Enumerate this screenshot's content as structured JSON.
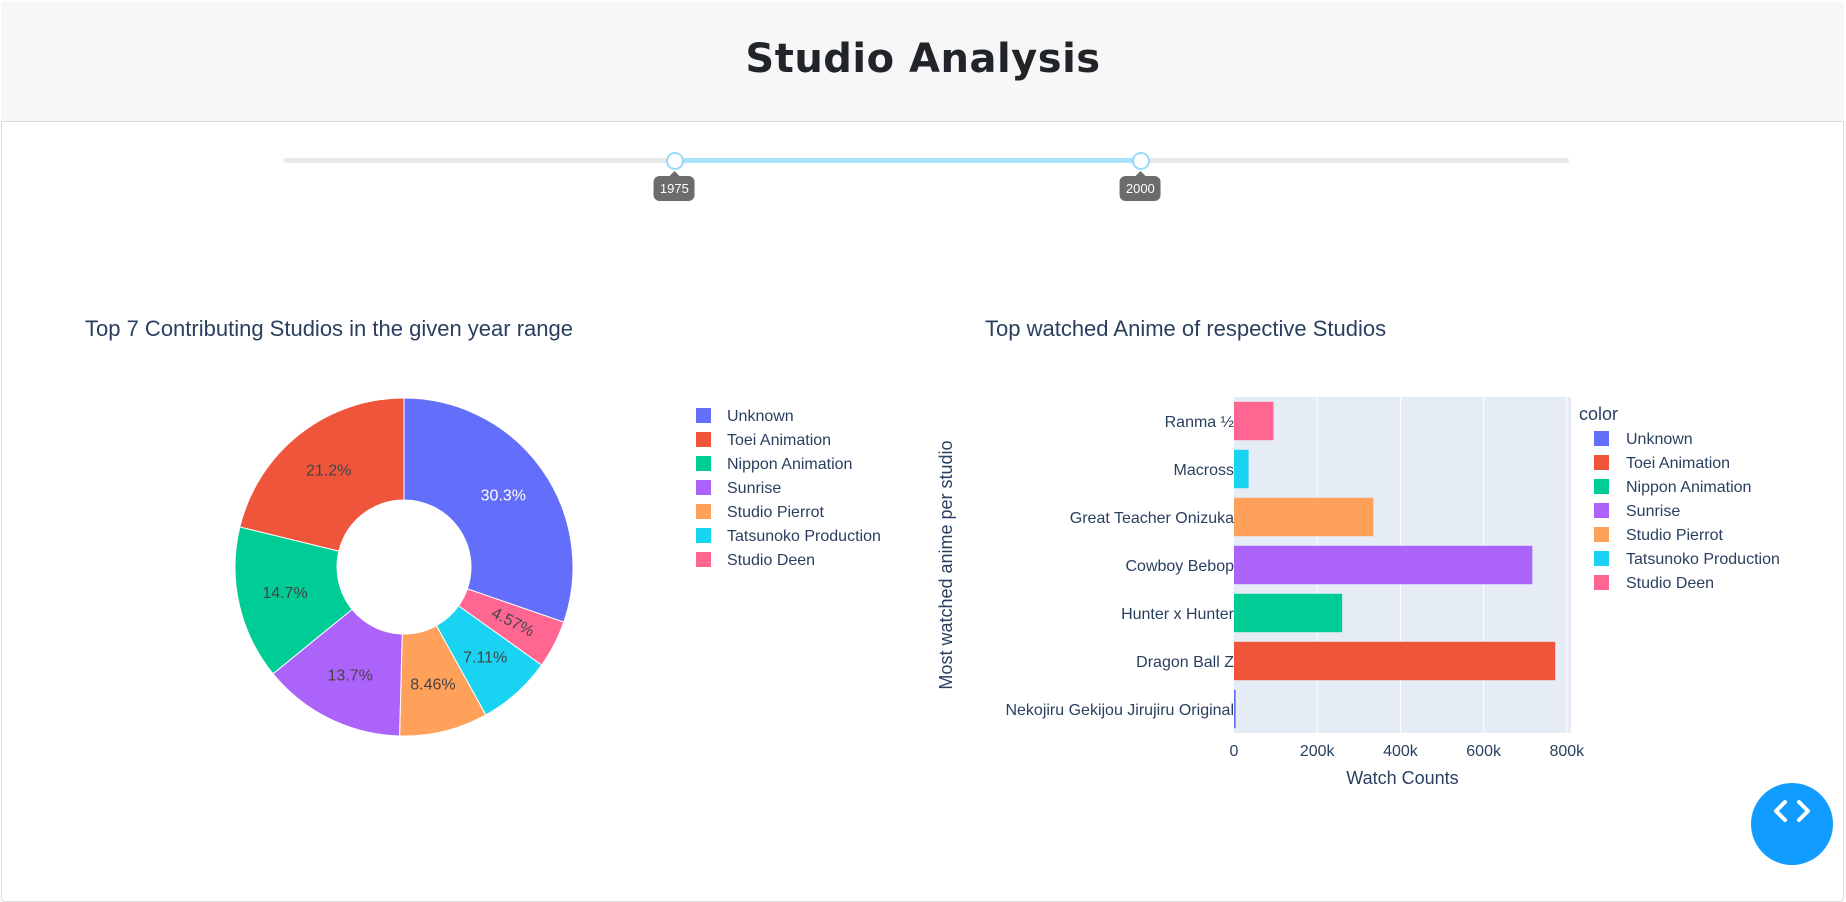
{
  "page": {
    "title": "Studio Analysis"
  },
  "slider": {
    "min_label": "1975",
    "max_label": "2000",
    "start": 1975,
    "end": 2000,
    "range_min": 1954,
    "range_max": 2023
  },
  "chart_data": [
    {
      "type": "pie",
      "hole": true,
      "title": "Top 7 Contributing Studios in the given year range",
      "labels": [
        "Unknown",
        "Toei Animation",
        "Nippon Animation",
        "Sunrise",
        "Studio Pierrot",
        "Tatsunoko Production",
        "Studio Deen"
      ],
      "values": [
        30.3,
        21.2,
        14.7,
        13.7,
        8.46,
        7.11,
        4.57
      ],
      "text": [
        "30.3%",
        "21.2%",
        "14.7%",
        "13.7%",
        "8.46%",
        "7.11%",
        "4.57%"
      ],
      "order": [
        "Unknown",
        "Studio Deen",
        "Tatsunoko Production",
        "Studio Pierrot",
        "Sunrise",
        "Nippon Animation",
        "Toei Animation"
      ],
      "colors": [
        "#636efa",
        "#ef553b",
        "#00cc96",
        "#ab63fa",
        "#ffa15a",
        "#19d3f3",
        "#ff6692"
      ],
      "legend": "right"
    },
    {
      "type": "bar",
      "orientation": "horizontal",
      "title": "Top watched Anime of respective Studios",
      "xlabel": "Watch Counts",
      "ylabel": "Most watched anime per studio",
      "xlim": [
        0,
        810000
      ],
      "xticks": [
        0,
        200000,
        400000,
        600000,
        800000
      ],
      "xtick_labels": [
        "0",
        "200k",
        "400k",
        "600k",
        "800k"
      ],
      "categories": [
        "Ranma ½",
        "Macross",
        "Great Teacher Onizuka",
        "Cowboy Bebop",
        "Hunter x Hunter",
        "Dragon Ball Z",
        "Nekojiru Gekijou Jirujiru Original"
      ],
      "values": [
        95000,
        35000,
        335000,
        717000,
        260000,
        772000,
        4000
      ],
      "bar_colors": [
        "#ff6692",
        "#19d3f3",
        "#ffa15a",
        "#ab63fa",
        "#00cc96",
        "#ef553b",
        "#636efa"
      ],
      "legend_title": "color",
      "legend": [
        "Unknown",
        "Toei Animation",
        "Nippon Animation",
        "Sunrise",
        "Studio Pierrot",
        "Tatsunoko Production",
        "Studio Deen"
      ],
      "legend_colors": [
        "#636efa",
        "#ef553b",
        "#00cc96",
        "#ab63fa",
        "#ffa15a",
        "#19d3f3",
        "#ff6692"
      ],
      "plot_bg": "#e5ecf6",
      "grid": true,
      "legend_placement": "right"
    }
  ]
}
